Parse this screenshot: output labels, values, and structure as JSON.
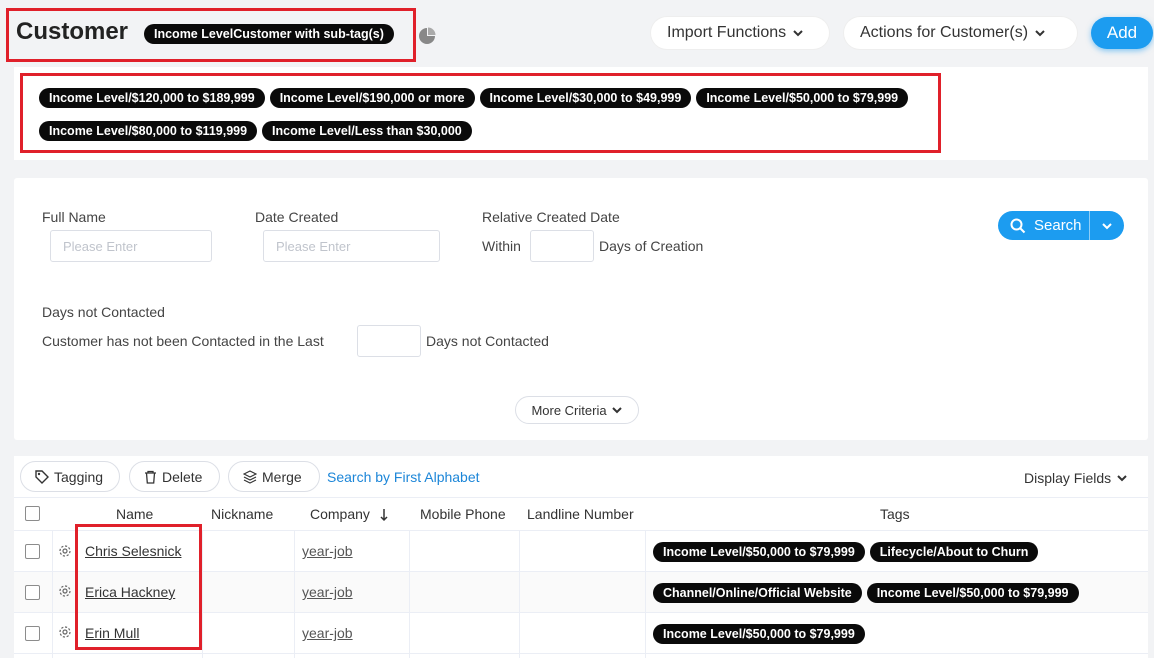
{
  "header": {
    "title": "Customer",
    "filter_badge": "Income LevelCustomer with sub-tag(s)",
    "import_label": "Import Functions",
    "actions_label": "Actions for Customer(s)",
    "add_label": "Add"
  },
  "selected_tags": [
    "Income Level/$120,000 to $189,999",
    "Income Level/$190,000 or more",
    "Income Level/$30,000 to $49,999",
    "Income Level/$50,000 to $79,999",
    "Income Level/$80,000 to $119,999",
    "Income Level/Less than $30,000"
  ],
  "filters": {
    "full_name_label": "Full Name",
    "full_name_placeholder": "Please Enter",
    "date_created_label": "Date Created",
    "date_created_placeholder": "Please Enter",
    "relative_label": "Relative Created Date",
    "within_label": "Within",
    "days_creation_label": "Days of Creation",
    "not_contacted_title": "Days not Contacted",
    "not_contacted_prefix": "Customer has not been Contacted in the Last",
    "not_contacted_suffix": "Days not Contacted",
    "search_label": "Search",
    "more_label": "More Criteria"
  },
  "toolbar": {
    "tagging_label": "Tagging",
    "delete_label": "Delete",
    "merge_label": "Merge",
    "alphabet_label": "Search by First Alphabet",
    "display_fields_label": "Display Fields"
  },
  "table": {
    "columns": [
      "Name",
      "Nickname",
      "Company",
      "Mobile Phone",
      "Landline Number",
      "Tags"
    ],
    "rows": [
      {
        "name": "Chris Selesnick",
        "company": "year-job",
        "tags": [
          "Income Level/$50,000 to $79,999",
          "Lifecycle/About to Churn"
        ]
      },
      {
        "name": "Erica Hackney",
        "company": "year-job",
        "tags": [
          "Channel/Online/Official Website",
          "Income Level/$50,000 to $79,999"
        ]
      },
      {
        "name": "Erin Mull",
        "company": "year-job",
        "tags": [
          "Income Level/$50,000 to $79,999"
        ]
      }
    ]
  },
  "colors": {
    "accent": "#1c9cf0",
    "highlight": "#e0202a",
    "pill": "#0a0a0a"
  }
}
